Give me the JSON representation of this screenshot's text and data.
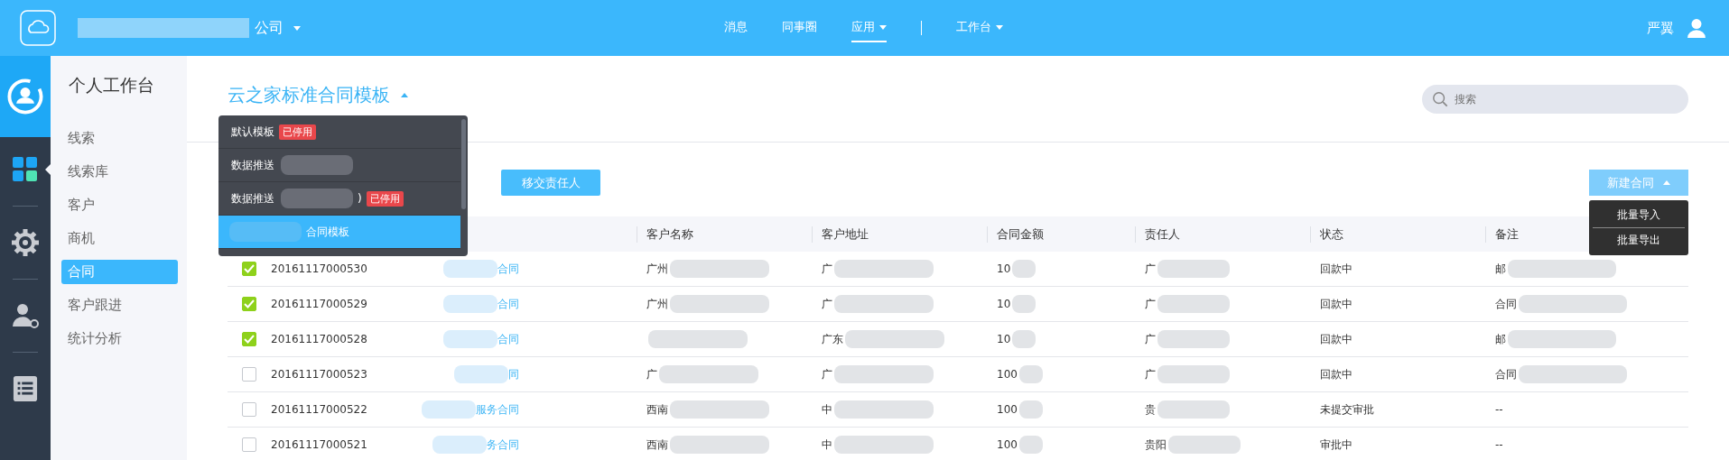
{
  "top_bar": {
    "company": "公司",
    "nav": [
      {
        "label": "消息",
        "selected": false,
        "caret": false
      },
      {
        "label": "同事圈",
        "selected": false,
        "caret": false
      },
      {
        "label": "应用",
        "selected": true,
        "caret": true
      },
      {
        "label": "工作台",
        "selected": false,
        "caret": true
      }
    ],
    "user": "严翼"
  },
  "rail": [
    {
      "kind": "grid",
      "selected": true
    },
    {
      "kind": "gear",
      "selected": false
    },
    {
      "kind": "user-settings",
      "selected": false
    },
    {
      "kind": "list",
      "selected": false
    }
  ],
  "sidebar": {
    "title": "个人工作台",
    "items": [
      {
        "label": "线索",
        "selected": false
      },
      {
        "label": "线索库",
        "selected": false
      },
      {
        "label": "客户",
        "selected": false
      },
      {
        "label": "商机",
        "selected": false
      },
      {
        "label": "合同",
        "selected": true
      },
      {
        "label": "客户跟进",
        "selected": false
      },
      {
        "label": "统计分析",
        "selected": false
      }
    ]
  },
  "template_title": "云之家标准合同模板",
  "template_menu": [
    {
      "label": "默认模板",
      "badge": "已停用",
      "redacted": false,
      "selected": false
    },
    {
      "label": "数据推送",
      "redacted": true,
      "selected": false
    },
    {
      "label": "数据推送",
      "suffix": ")",
      "badge": "已停用",
      "redacted": true,
      "selected": false
    },
    {
      "label": "合同模板",
      "redacted": true,
      "selected": true
    }
  ],
  "search": {
    "placeholder": "搜索"
  },
  "transfer_button": "移交责任人",
  "new_button": "新建合同",
  "new_menu": [
    "批量导入",
    "批量导出"
  ],
  "table": {
    "columns": [
      "客户名称",
      "客户地址",
      "合同金额",
      "责任人",
      "状态",
      "备注"
    ],
    "rows": [
      {
        "checked": true,
        "number": "20161117000530",
        "name": "合同",
        "customer": "广州",
        "address": "广",
        "amount": "10",
        "owner": "广",
        "status": "回款中",
        "note": "邮"
      },
      {
        "checked": true,
        "number": "20161117000529",
        "name": "合同",
        "customer": "广州",
        "address": "广",
        "amount": "10",
        "owner": "广",
        "status": "回款中",
        "note": "合同"
      },
      {
        "checked": true,
        "number": "20161117000528",
        "name": "合同",
        "address": "广东",
        "amount": "10",
        "owner": "广",
        "status": "回款中",
        "note": "邮"
      },
      {
        "checked": false,
        "number": "20161117000523",
        "name": "同",
        "customer": "广",
        "address": "广",
        "amount": "100",
        "owner": "广",
        "status": "回款中",
        "note": "合同"
      },
      {
        "checked": false,
        "number": "20161117000522",
        "name": "服务合同",
        "customer": "西南",
        "address": "中",
        "amount": "100",
        "owner": "贵",
        "status": "未提交审批",
        "note": "--"
      },
      {
        "checked": false,
        "number": "20161117000521",
        "name": "务合同",
        "customer": "西南",
        "address": "中",
        "amount": "100",
        "owner": "贵阳",
        "status": "审批中",
        "note": "--"
      }
    ]
  }
}
